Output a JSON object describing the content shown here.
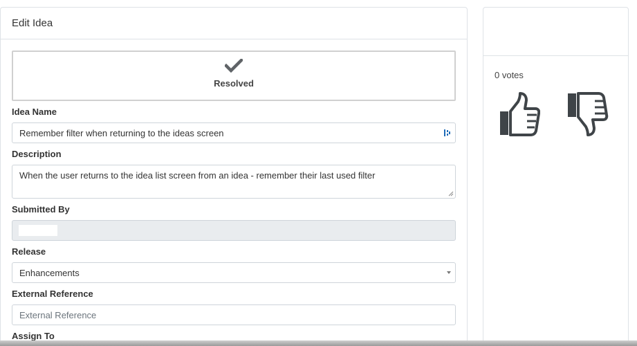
{
  "panel": {
    "title": "Edit Idea"
  },
  "status": {
    "label": "Resolved",
    "icon": "check-icon"
  },
  "fields": {
    "idea_name": {
      "label": "Idea Name",
      "value": "Remember filter when returning to the ideas screen"
    },
    "description": {
      "label": "Description",
      "value": "When the user returns to the idea list screen from an idea - remember their last used filter"
    },
    "submitted_by": {
      "label": "Submitted By",
      "value": ""
    },
    "release": {
      "label": "Release",
      "value": "Enhancements"
    },
    "external_reference": {
      "label": "External Reference",
      "placeholder": "External Reference"
    },
    "assign_to": {
      "label": "Assign To"
    }
  },
  "votes": {
    "count_label": "0 votes",
    "up_icon": "thumbs-up-icon",
    "down_icon": "thumbs-down-icon"
  },
  "colors": {
    "icon": "#3f4448",
    "border": "#dee2e6",
    "readonly_bg": "#e9ecef"
  }
}
